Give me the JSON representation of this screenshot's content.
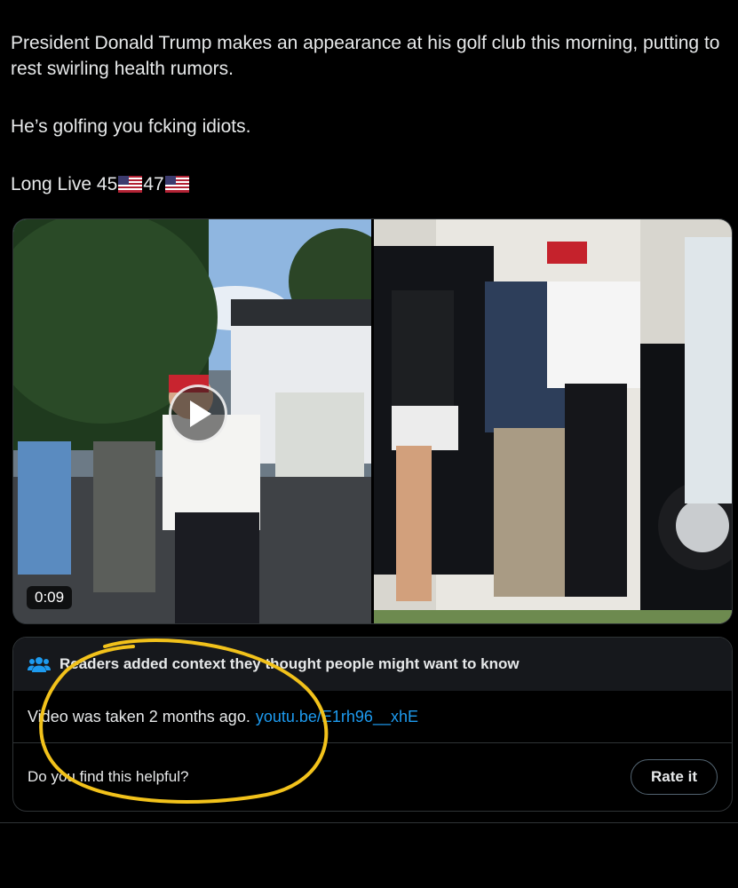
{
  "tweet": {
    "line1": "President Donald Trump  makes an appearance at his golf club this morning, putting to rest swirling health rumors.",
    "line2": "He’s golfing you fcking idiots.",
    "line3_prefix": "Long Live 45",
    "line3_mid": "47",
    "flag_icon": "us-flag-icon"
  },
  "media": {
    "video_duration": "0:09",
    "play_icon": "play-icon"
  },
  "community_note": {
    "header": "Readers added context they thought people might want to know",
    "header_icon": "people-icon",
    "body_text": "Video was taken 2 months ago.",
    "link_text": "youtu.be/E1rh96__xhE",
    "footer_question": "Do you find this helpful?",
    "rate_button": "Rate it"
  },
  "colors": {
    "background": "#000000",
    "text": "#e7e9ea",
    "link": "#1d9bf0",
    "border": "#2f3336",
    "annotation": "#f2c21b"
  }
}
